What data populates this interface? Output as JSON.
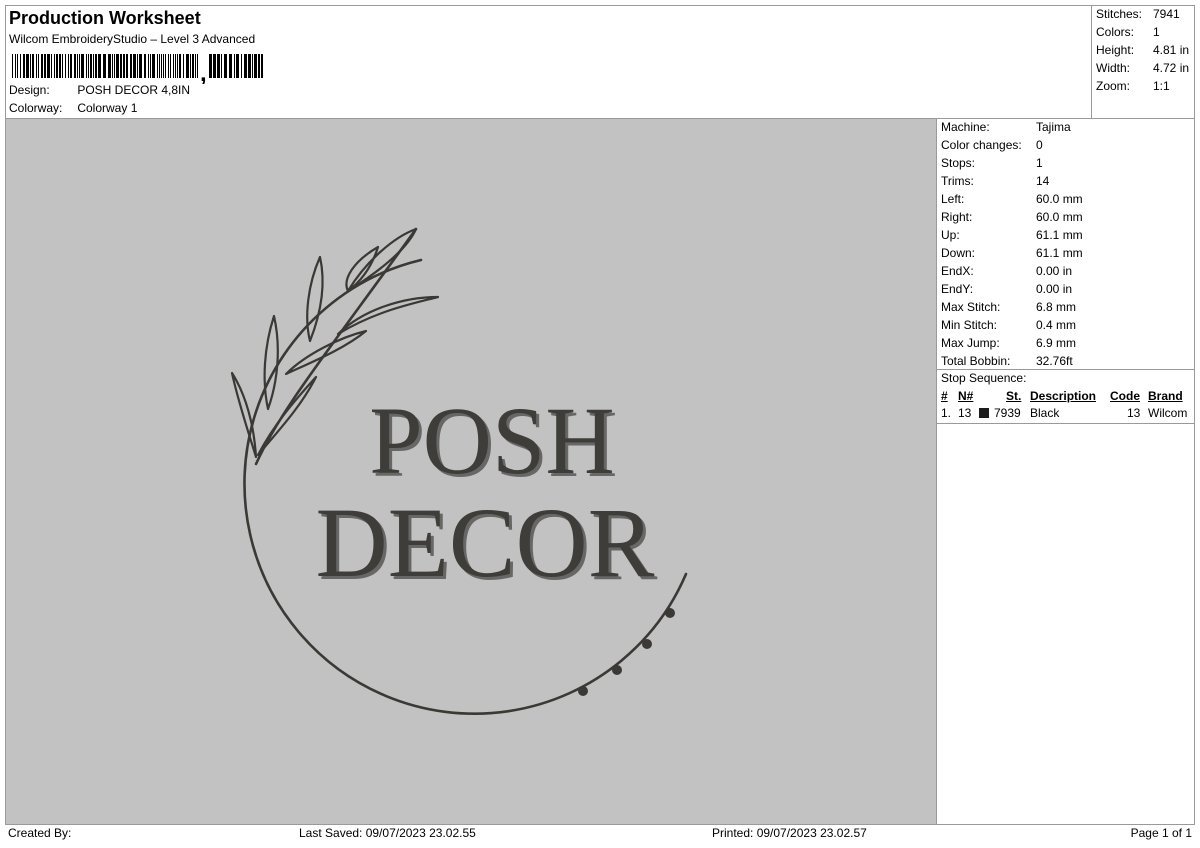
{
  "header": {
    "title": "Production Worksheet",
    "subtitle": "Wilcom EmbroideryStudio – Level 3 Advanced",
    "design_label": "Design:",
    "design_value": "POSH DECOR 4,8IN",
    "colorway_label": "Colorway:",
    "colorway_value": "Colorway 1"
  },
  "summary": [
    {
      "label": "Stitches:",
      "value": "7941"
    },
    {
      "label": "Colors:",
      "value": "1"
    },
    {
      "label": "Height:",
      "value": "4.81 in"
    },
    {
      "label": "Width:",
      "value": "4.72 in"
    },
    {
      "label": "Zoom:",
      "value": "1:1"
    }
  ],
  "machine_info": [
    {
      "label": "Machine:",
      "value": "Tajima"
    },
    {
      "label": "Color changes:",
      "value": "0"
    },
    {
      "label": "Stops:",
      "value": "1"
    },
    {
      "label": "Trims:",
      "value": "14"
    },
    {
      "label": "Left:",
      "value": "60.0 mm"
    },
    {
      "label": "Right:",
      "value": "60.0 mm"
    },
    {
      "label": "Up:",
      "value": "61.1 mm"
    },
    {
      "label": "Down:",
      "value": "61.1 mm"
    },
    {
      "label": "EndX:",
      "value": "0.00 in"
    },
    {
      "label": "EndY:",
      "value": "0.00 in"
    },
    {
      "label": "Max Stitch:",
      "value": "6.8 mm"
    },
    {
      "label": "Min Stitch:",
      "value": "0.4 mm"
    },
    {
      "label": "Max Jump:",
      "value": "6.9 mm"
    },
    {
      "label": "Total Bobbin:",
      "value": "32.76ft"
    }
  ],
  "stop_sequence": {
    "title": "Stop Sequence:",
    "headers": {
      "num": "#",
      "n": "N#",
      "st": "St.",
      "description": "Description",
      "code": "Code",
      "brand": "Brand"
    },
    "rows": [
      {
        "num": "1.",
        "n": "13",
        "st": "7939",
        "description": "Black",
        "code": "13",
        "brand": "Wilcom",
        "color": "#1c1c1c"
      }
    ]
  },
  "design": {
    "line1": "POSH",
    "line2": "DECOR",
    "thread_color": "#3a3935",
    "canvas_color": "#c2c2c2"
  },
  "footer": {
    "created_by": "Created By:",
    "last_saved": "Last Saved: 09/07/2023 23.02.55",
    "printed": "Printed: 09/07/2023 23.02.57",
    "page": "Page 1 of 1"
  }
}
